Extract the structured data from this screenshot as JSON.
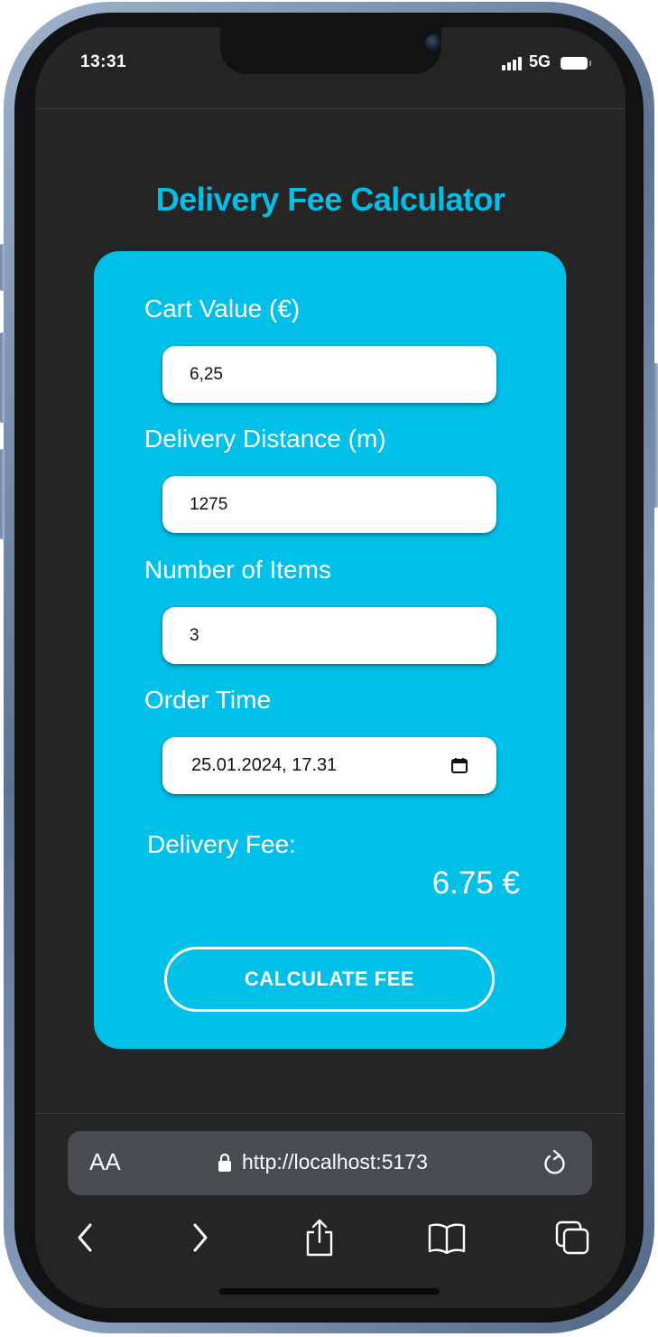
{
  "status_bar": {
    "time": "13:31",
    "network": "5G"
  },
  "app": {
    "title": "Delivery Fee Calculator",
    "accent_color": "#00c0e8",
    "background_color": "#252525"
  },
  "form": {
    "cart_value": {
      "label": "Cart Value (€)",
      "value": "6,25"
    },
    "delivery_distance": {
      "label": "Delivery Distance (m)",
      "value": "1275"
    },
    "number_of_items": {
      "label": "Number of Items",
      "value": "3"
    },
    "order_time": {
      "label": "Order Time",
      "value": "25.01.2024, 17.31",
      "icon": "calendar-icon"
    }
  },
  "result": {
    "label": "Delivery Fee:",
    "value": "6.75 €"
  },
  "calculate_button": {
    "label": "CALCULATE FEE"
  },
  "browser": {
    "text_size_label": "AA",
    "url": "http://localhost:5173",
    "icons": [
      "lock-icon",
      "reload-icon",
      "back-icon",
      "forward-icon",
      "share-icon",
      "bookmarks-icon",
      "tabs-icon"
    ]
  }
}
